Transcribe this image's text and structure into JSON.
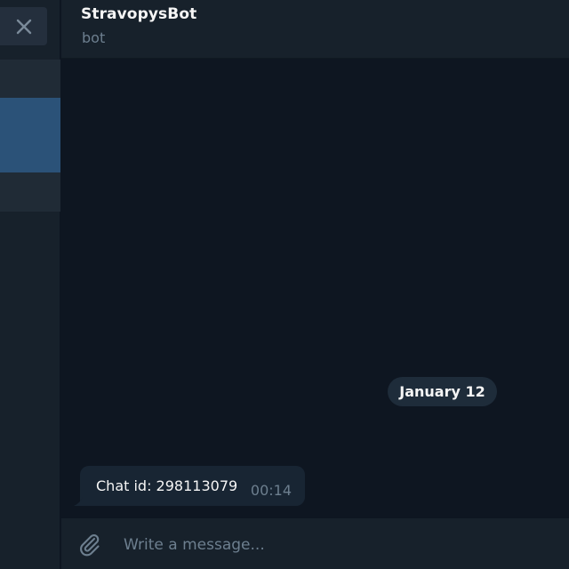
{
  "header": {
    "title": "StravopysBot",
    "subtitle": "bot"
  },
  "sidebar": {
    "close_icon": "close-icon",
    "items": [
      {
        "id": "chat-a",
        "selected": false
      },
      {
        "id": "chat-b",
        "selected": true
      },
      {
        "id": "chat-c",
        "selected": false
      }
    ]
  },
  "messages": {
    "date_separator": "January 12",
    "items": [
      {
        "text": "Chat id: 298113079",
        "time": "00:14"
      }
    ]
  },
  "composer": {
    "placeholder": "Write a message...",
    "attach_icon": "paperclip-icon"
  },
  "colors": {
    "background": "#0e1621",
    "panel": "#17212b",
    "selected": "#2b5278",
    "bubble": "#182533",
    "muted_text": "#6d7f8f",
    "text": "#f5f5f5"
  }
}
